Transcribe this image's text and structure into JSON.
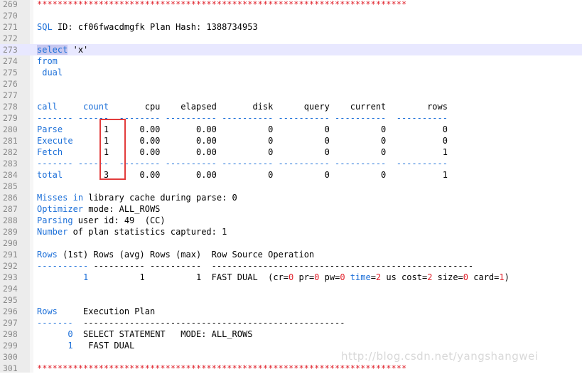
{
  "lines": [
    {
      "n": "269",
      "t": "************************************************************************"
    },
    {
      "n": "270",
      "t": ""
    },
    {
      "n": "271",
      "t": "SQL ID: cf06fwacdmgfk Plan Hash: 1388734953"
    },
    {
      "n": "272",
      "t": ""
    },
    {
      "n": "273",
      "t": "select 'x'"
    },
    {
      "n": "274",
      "t": "from"
    },
    {
      "n": "275",
      "t": " dual"
    },
    {
      "n": "276",
      "t": ""
    },
    {
      "n": "277",
      "t": ""
    },
    {
      "n": "278",
      "t": "call     count       cpu    elapsed       disk      query    current        rows"
    },
    {
      "n": "279",
      "t": "------- ------  -------- ---------- ---------- ---------- ----------  ----------"
    },
    {
      "n": "280",
      "t": "Parse        1      0.00       0.00          0          0          0           0"
    },
    {
      "n": "281",
      "t": "Execute      1      0.00       0.00          0          0          0           0"
    },
    {
      "n": "282",
      "t": "Fetch        1      0.00       0.00          0          0          0           1"
    },
    {
      "n": "283",
      "t": "------- ------  -------- ---------- ---------- ---------- ----------  ----------"
    },
    {
      "n": "284",
      "t": "total        3      0.00       0.00          0          0          0           1"
    },
    {
      "n": "285",
      "t": ""
    },
    {
      "n": "286",
      "t": "Misses in library cache during parse: 0"
    },
    {
      "n": "287",
      "t": "Optimizer mode: ALL_ROWS"
    },
    {
      "n": "288",
      "t": "Parsing user id: 49  (CC)"
    },
    {
      "n": "289",
      "t": "Number of plan statistics captured: 1"
    },
    {
      "n": "290",
      "t": ""
    },
    {
      "n": "291",
      "t": "Rows (1st) Rows (avg) Rows (max)  Row Source Operation"
    },
    {
      "n": "292",
      "t": "---------- ---------- ----------  ---------------------------------------------------"
    },
    {
      "n": "293",
      "t": "         1          1          1  FAST DUAL  (cr=0 pr=0 pw=0 time=2 us cost=2 size=0 card=1)"
    },
    {
      "n": "294",
      "t": ""
    },
    {
      "n": "295",
      "t": ""
    },
    {
      "n": "296",
      "t": "Rows     Execution Plan"
    },
    {
      "n": "297",
      "t": "-------  ---------------------------------------------------"
    },
    {
      "n": "298",
      "t": "      0  SELECT STATEMENT   MODE: ALL_ROWS"
    },
    {
      "n": "299",
      "t": "      1   FAST DUAL"
    },
    {
      "n": "300",
      "t": ""
    },
    {
      "n": "301",
      "t": "************************************************************************"
    }
  ],
  "watermark": "http://blog.csdn.net/yangshangwei",
  "colors": {
    "keyword": "#1a6ed8",
    "separator": "#e0202a",
    "highlight_box": "#e23c3c",
    "current_line": "#e8e8ff"
  }
}
